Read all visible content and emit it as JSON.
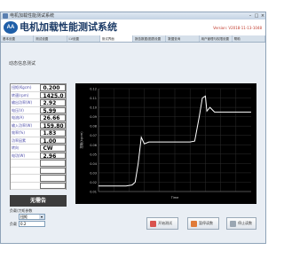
{
  "window": {
    "title": "电机加载性能测试系统"
  },
  "header": {
    "title": "电机加载性能测试系统",
    "logo_text": "AA",
    "version": "Version: V2018-11-13-1048"
  },
  "tabs": [
    {
      "label": "基本设置"
    },
    {
      "label": "测试设置"
    },
    {
      "label": "I-V设置"
    },
    {
      "label": "测试界面"
    },
    {
      "label": "报告数据/图表设置"
    },
    {
      "label": "数据查询"
    },
    {
      "label": "用户管理与权限设置"
    },
    {
      "label": "帮助"
    }
  ],
  "section": {
    "title": "动态信息测试"
  },
  "params": [
    {
      "label": "扭矩(Kgcm)",
      "value": "0.200"
    },
    {
      "label": "转速(rpm)",
      "value": "1425.0"
    },
    {
      "label": "输出功率(W)",
      "value": "2.92"
    },
    {
      "label": "电压(V)",
      "value": "5.99"
    },
    {
      "label": "电流(A)",
      "value": "26.66"
    },
    {
      "label": "输入功率(W)",
      "value": "159.80"
    },
    {
      "label": "效率(%)",
      "value": "1.83"
    },
    {
      "label": "功率因素",
      "value": "1.00"
    },
    {
      "label": "转向",
      "value": "CW"
    },
    {
      "label": "电功(W)",
      "value": "2.96"
    },
    {
      "label": "",
      "value": ""
    },
    {
      "label": "",
      "value": ""
    },
    {
      "label": "",
      "value": ""
    },
    {
      "label": "",
      "value": ""
    }
  ],
  "result": {
    "label": "无需告"
  },
  "controls": {
    "mode_label": "负载/力矩参数",
    "mode_value": "扭矩",
    "level_label": "负载",
    "level_value": "0.2"
  },
  "chart_data": {
    "type": "line",
    "ylabel": "扭矩(kgcm)",
    "xlabel": "Time",
    "ylim": [
      0.01,
      0.12
    ],
    "yticks": [
      "0.12",
      "0.11",
      "0.10",
      "0.09",
      "0.08",
      "0.07",
      "0.06",
      "0.05",
      "0.04",
      "0.03",
      "0.02",
      "0.01"
    ],
    "xlim": [
      0,
      100
    ],
    "grid": true,
    "series": [
      {
        "color": "#ffffff",
        "values": [
          [
            0,
            0.016
          ],
          [
            18,
            0.016
          ],
          [
            22,
            0.017
          ],
          [
            24,
            0.02
          ],
          [
            26,
            0.04
          ],
          [
            28,
            0.068
          ],
          [
            30,
            0.061
          ],
          [
            33,
            0.063
          ],
          [
            37,
            0.063
          ],
          [
            60,
            0.063
          ],
          [
            63,
            0.064
          ],
          [
            66,
            0.09
          ],
          [
            68,
            0.11
          ],
          [
            70,
            0.112
          ],
          [
            71,
            0.096
          ],
          [
            73,
            0.1
          ],
          [
            76,
            0.095
          ],
          [
            80,
            0.095
          ],
          [
            100,
            0.095
          ]
        ]
      }
    ]
  },
  "buttons": {
    "start": "开始测试",
    "pause": "暂停读数",
    "stop": "停止读数"
  }
}
